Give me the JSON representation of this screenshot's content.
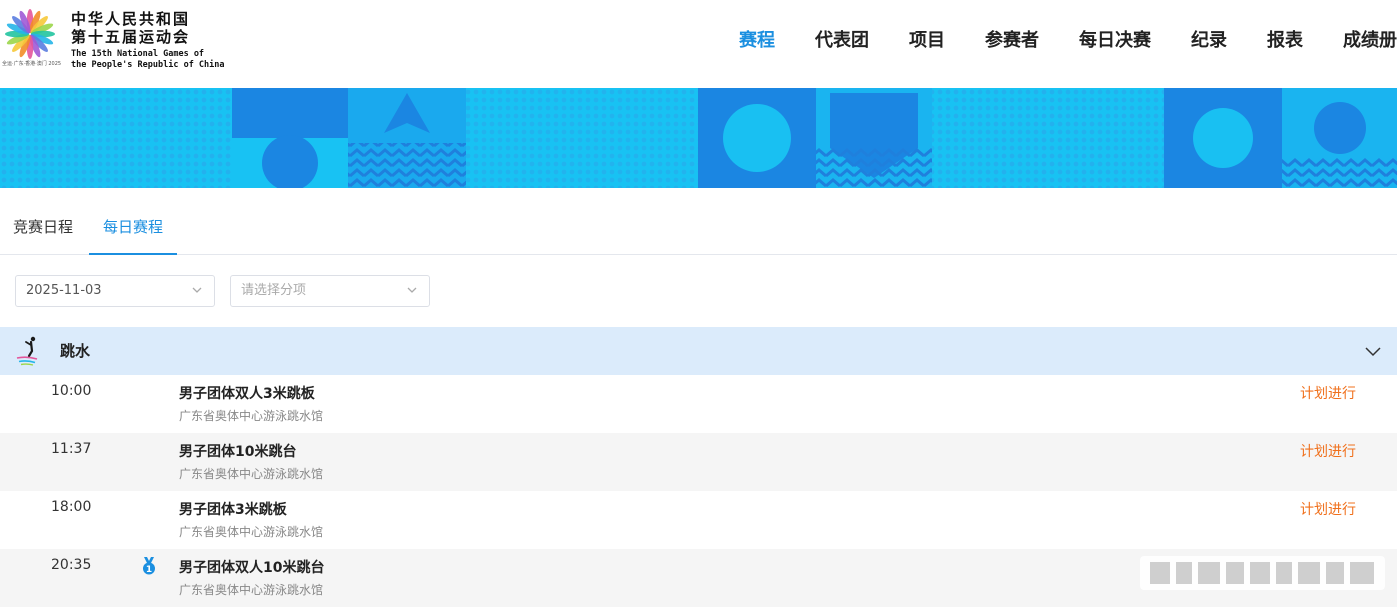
{
  "logo": {
    "title_cn_1": "中华人民共和国",
    "title_cn_2": "第十五届运动会",
    "title_en_1": "The 15th National Games of",
    "title_en_2": "the People's Republic of China",
    "sub": "全运·广东·香港·澳门 2025"
  },
  "nav": {
    "items": [
      "赛程",
      "代表团",
      "项目",
      "参赛者",
      "每日决赛",
      "纪录",
      "报表",
      "成绩册"
    ],
    "active": "赛程"
  },
  "tabs": {
    "items": [
      "竞赛日程",
      "每日赛程"
    ],
    "active": "每日赛程"
  },
  "filters": {
    "date": "2025-11-03",
    "discipline_placeholder": "请选择分项"
  },
  "section": {
    "title": "跳水",
    "icon": "diving-icon"
  },
  "events": [
    {
      "time": "10:00",
      "name": "男子团体双人3米跳板",
      "venue": "广东省奥体中心游泳跳水馆",
      "status": "计划进行",
      "medal": false
    },
    {
      "time": "11:37",
      "name": "男子团体10米跳台",
      "venue": "广东省奥体中心游泳跳水馆",
      "status": "计划进行",
      "medal": false
    },
    {
      "time": "18:00",
      "name": "男子团体3米跳板",
      "venue": "广东省奥体中心游泳跳水馆",
      "status": "计划进行",
      "medal": false
    },
    {
      "time": "20:35",
      "name": "男子团体双人10米跳台",
      "venue": "广东省奥体中心游泳跳水馆",
      "status": "",
      "medal": true
    }
  ],
  "icons": {
    "medal": "medal-icon",
    "chevron": "chevron-down-icon"
  },
  "colors": {
    "accent": "#1b8fe0",
    "status": "#f0701c",
    "section_bg": "#dbebfb",
    "banner": "#1ab8f0"
  }
}
